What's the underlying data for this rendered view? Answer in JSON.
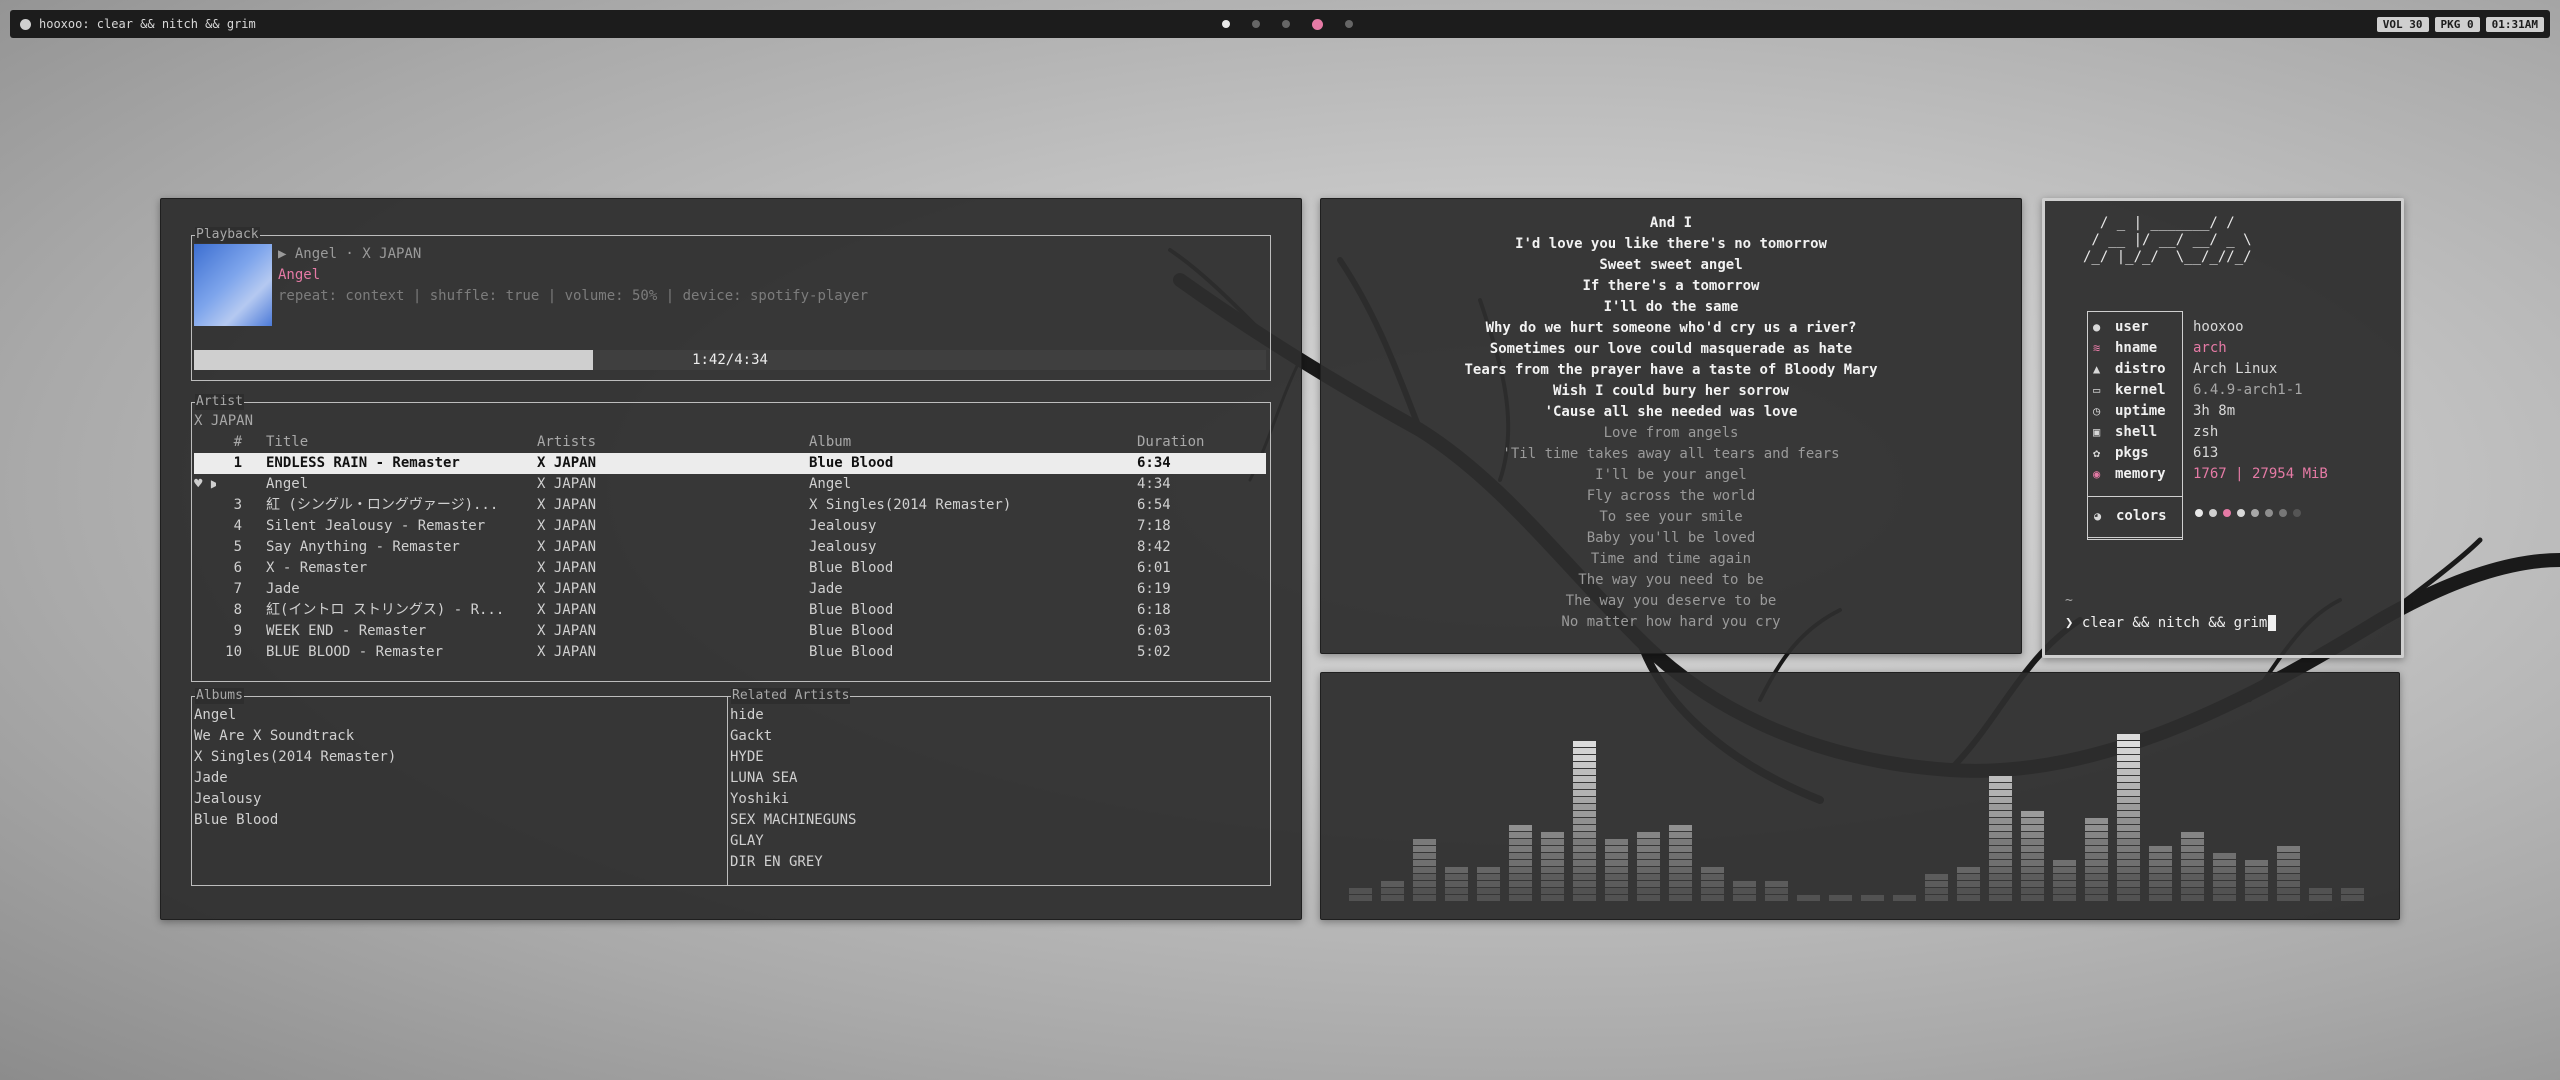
{
  "topbar": {
    "title": "hooxoo: clear && nitch && grim",
    "workspaces": [
      "active",
      "inactive",
      "inactive",
      "urgent",
      "inactive"
    ],
    "status": [
      "VOL 30",
      "PKG 0",
      "01:31AM"
    ]
  },
  "playback": {
    "title": "Playback",
    "now_playing": "▶ Angel · X JAPAN",
    "song": "Angel",
    "meta": "repeat: context | shuffle: true | volume: 50% | device: spotify-player",
    "progress_text": "1:42/4:34",
    "progress_fraction": 0.372
  },
  "artist_panel": {
    "title": "Artist",
    "name": "X JAPAN",
    "columns": {
      "num": "#",
      "title": "Title",
      "artists": "Artists",
      "album": "Album",
      "duration": "Duration"
    },
    "tracks": [
      {
        "mark": "",
        "num": "1",
        "title": "ENDLESS RAIN - Remaster",
        "artist": "X JAPAN",
        "album": "Blue Blood",
        "duration": "6:34"
      },
      {
        "mark": "♥ ▶",
        "num": "",
        "title": "Angel",
        "artist": "X JAPAN",
        "album": "Angel",
        "duration": "4:34"
      },
      {
        "mark": "",
        "num": "3",
        "title": "紅 (シングル・ロングヴァージ)...",
        "artist": "X JAPAN",
        "album": "X Singles(2014 Remaster)",
        "duration": "6:54"
      },
      {
        "mark": "",
        "num": "4",
        "title": "Silent Jealousy - Remaster",
        "artist": "X JAPAN",
        "album": "Jealousy",
        "duration": "7:18"
      },
      {
        "mark": "",
        "num": "5",
        "title": "Say Anything - Remaster",
        "artist": "X JAPAN",
        "album": "Jealousy",
        "duration": "8:42"
      },
      {
        "mark": "",
        "num": "6",
        "title": "X - Remaster",
        "artist": "X JAPAN",
        "album": "Blue Blood",
        "duration": "6:01"
      },
      {
        "mark": "",
        "num": "7",
        "title": "Jade",
        "artist": "X JAPAN",
        "album": "Jade",
        "duration": "6:19"
      },
      {
        "mark": "",
        "num": "8",
        "title": "紅(イントロ ストリングス) - R...",
        "artist": "X JAPAN",
        "album": "Blue Blood",
        "duration": "6:18"
      },
      {
        "mark": "",
        "num": "9",
        "title": "WEEK END - Remaster",
        "artist": "X JAPAN",
        "album": "Blue Blood",
        "duration": "6:03"
      },
      {
        "mark": "",
        "num": "10",
        "title": "BLUE BLOOD - Remaster",
        "artist": "X JAPAN",
        "album": "Blue Blood",
        "duration": "5:02"
      }
    ]
  },
  "albums": {
    "title": "Albums",
    "items": [
      "Angel",
      "We Are X Soundtrack",
      "X Singles(2014 Remaster)",
      "Jade",
      "Jealousy",
      "Blue Blood"
    ]
  },
  "related": {
    "title": "Related Artists",
    "items": [
      "hide",
      "Gackt",
      "HYDE",
      "LUNA SEA",
      "Yoshiki",
      "SEX MACHINEGUNS",
      "GLAY",
      "DIR EN GREY"
    ]
  },
  "lyrics": {
    "past": [
      "And I",
      "I'd love you like there's no tomorrow",
      "Sweet sweet angel",
      "If there's a tomorrow",
      "I'll do the same",
      "Why do we hurt someone who'd cry us a river?",
      "Sometimes our love could masquerade as hate",
      "Tears from the prayer have a taste of Bloody Mary",
      "Wish I could bury her sorrow",
      "'Cause all she needed was love"
    ],
    "future": [
      "Love from angels",
      "'Til time takes away all tears and fears",
      "I'll be your angel",
      "Fly across the world",
      "To see your smile",
      "Baby you'll be loved",
      "Time and time again",
      "The way you need to be",
      "The way you deserve to be",
      "No matter how hard you cry"
    ]
  },
  "fetch": {
    "ascii": "  / _ | _______/ /\n / __ |/ __/ __/ _ \\\n/_/ |_/_/  \\__/_//_/",
    "rows": [
      {
        "icon": "user-icon",
        "glyph": "●",
        "label": "user",
        "value": "hooxoo",
        "style": ""
      },
      {
        "icon": "hostname-icon",
        "glyph": "≋",
        "label": "hname",
        "value": "arch",
        "style": "pink"
      },
      {
        "icon": "distro-icon",
        "glyph": "▲",
        "label": "distro",
        "value": "Arch Linux",
        "style": ""
      },
      {
        "icon": "kernel-icon",
        "glyph": "▭",
        "label": "kernel",
        "value": "6.4.9-arch1-1",
        "style": "dim"
      },
      {
        "icon": "clock-icon",
        "glyph": "◷",
        "label": "uptime",
        "value": "3h 8m",
        "style": ""
      },
      {
        "icon": "shell-icon",
        "glyph": "▣",
        "label": "shell",
        "value": "zsh",
        "style": ""
      },
      {
        "icon": "package-icon",
        "glyph": "✿",
        "label": "pkgs",
        "value": "613",
        "style": ""
      },
      {
        "icon": "memory-icon",
        "glyph": "◉",
        "label": "memory",
        "value": "1767 | 27954 MiB",
        "style": "pink"
      }
    ],
    "colors_label": "colors",
    "swatches": [
      "#e8e8e8",
      "#cfcfcf",
      "#e57aa5",
      "#d8d8d8",
      "#a8a8a8",
      "#8e8e8e",
      "#777777",
      "#555555"
    ],
    "tilde": "~",
    "prompt": "❯ clear && nitch && grim"
  },
  "visualizer": {
    "levels": [
      2,
      3,
      9,
      5,
      5,
      11,
      10,
      23,
      9,
      10,
      11,
      5,
      3,
      3,
      1,
      1,
      1,
      1,
      4,
      5,
      18,
      13,
      6,
      12,
      24,
      8,
      10,
      7,
      6,
      8,
      2,
      2
    ]
  }
}
